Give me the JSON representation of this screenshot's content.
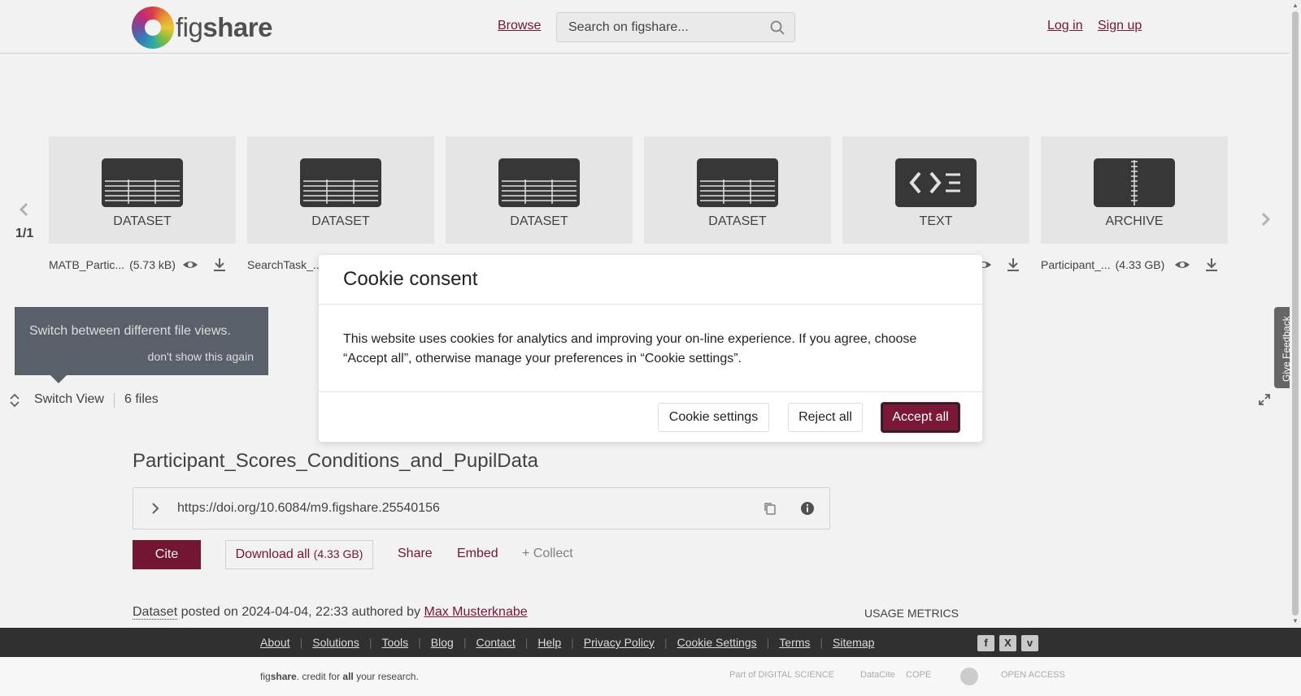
{
  "header": {
    "logo_text_light": "fig",
    "logo_text_bold": "share",
    "browse": "Browse",
    "search_placeholder": "Search on figshare...",
    "login": "Log in",
    "signup": "Sign up"
  },
  "carousel": {
    "page_indicator": "1/1",
    "files": [
      {
        "type": "DATASET",
        "name": "MATB_Partic...",
        "size": "(5.73 kB)",
        "icon": "table-icon"
      },
      {
        "type": "DATASET",
        "name": "SearchTask_...",
        "size": "",
        "icon": "table-icon"
      },
      {
        "type": "DATASET",
        "name": "",
        "size": "",
        "icon": "table-icon"
      },
      {
        "type": "DATASET",
        "name": "",
        "size": "",
        "icon": "table-icon"
      },
      {
        "type": "TEXT",
        "name": "",
        "size": "",
        "icon": "code-icon"
      },
      {
        "type": "ARCHIVE",
        "name": "Participant_...",
        "size": "(4.33 GB)",
        "icon": "zip-icon"
      }
    ]
  },
  "tooltip": {
    "text": "Switch between different file views.",
    "dismiss": "don't show this again"
  },
  "viewbar": {
    "switch_view": "Switch View",
    "files_count": "6 files"
  },
  "item": {
    "title": "Participant_Scores_Conditions_and_PupilData",
    "doi": "https://doi.org/10.6084/m9.figshare.25540156",
    "cite": "Cite",
    "download_label": "Download all ",
    "download_size": "(4.33 GB)",
    "share": "Share",
    "embed": "Embed",
    "collect": "+ Collect",
    "posted_type": "Dataset",
    "posted_text": " posted on 2024-04-04, 22:33 authored by ",
    "author": "Max Musterknabe",
    "usage_metrics": "USAGE METRICS"
  },
  "footer": {
    "links": [
      "About",
      "Solutions",
      "Tools",
      "Blog",
      "Contact",
      "Help",
      "Privacy Policy",
      "Cookie Settings",
      "Terms",
      "Sitemap"
    ],
    "credit_fig": "fig",
    "credit_share": "share",
    "credit_mid": ". credit for ",
    "credit_all": "all",
    "credit_end": " your research.",
    "partner_digital_science": "Part of DIGITAL SCIENCE",
    "partner_datacite": "DataCite",
    "partner_cope": "COPE",
    "partner_open_access": "OPEN ACCESS"
  },
  "cookie_modal": {
    "title": "Cookie consent",
    "body": "This website uses cookies for analytics and improving your on-line experience. If you agree, choose “Accept all”, otherwise manage your preferences in “Cookie settings”.",
    "settings": "Cookie settings",
    "reject": "Reject all",
    "accept": "Accept all"
  },
  "feedback": "Give Feedback",
  "colors": {
    "brand": "#7a1835",
    "footer": "#303030",
    "thumb": "#3a3a3a"
  }
}
